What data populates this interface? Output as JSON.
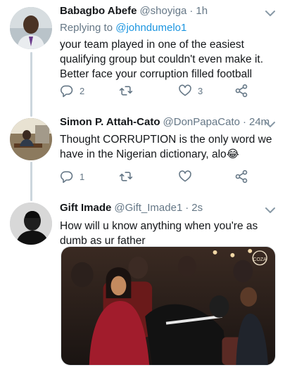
{
  "colors": {
    "text": "#14171a",
    "secondary": "#657786",
    "link": "#1b95e0",
    "thread_line": "#ccd6dd"
  },
  "tweets": [
    {
      "name": "Babagbo Abefe",
      "handle": "@shoyiga",
      "separator": "·",
      "time": "1h",
      "reply_prefix": "Replying to",
      "reply_to": "@johndumelo1",
      "text": "your team played in one of the easiest qualifying group but couldn't even make it.  Better face your corruption filled football",
      "reply_count": "2",
      "retweet_count": "",
      "like_count": "3",
      "icons": [
        "reply-icon",
        "retweet-icon",
        "like-icon",
        "share-icon",
        "chevron-down-icon"
      ]
    },
    {
      "name": "Simon P. Attah-Cato",
      "handle": "@DonPapaCato",
      "separator": "·",
      "time": "24m",
      "text": "Thought CORRUPTION is the only word we have in the Nigerian dictionary, alo😂",
      "reply_count": "1",
      "retweet_count": "",
      "like_count": ""
    },
    {
      "name": "Gift Imade",
      "handle": "@Gift_Imade1",
      "separator": "·",
      "time": "2s",
      "text": "How will u know anything when you're as dumb as ur father",
      "media_watermark": "COZA"
    }
  ]
}
